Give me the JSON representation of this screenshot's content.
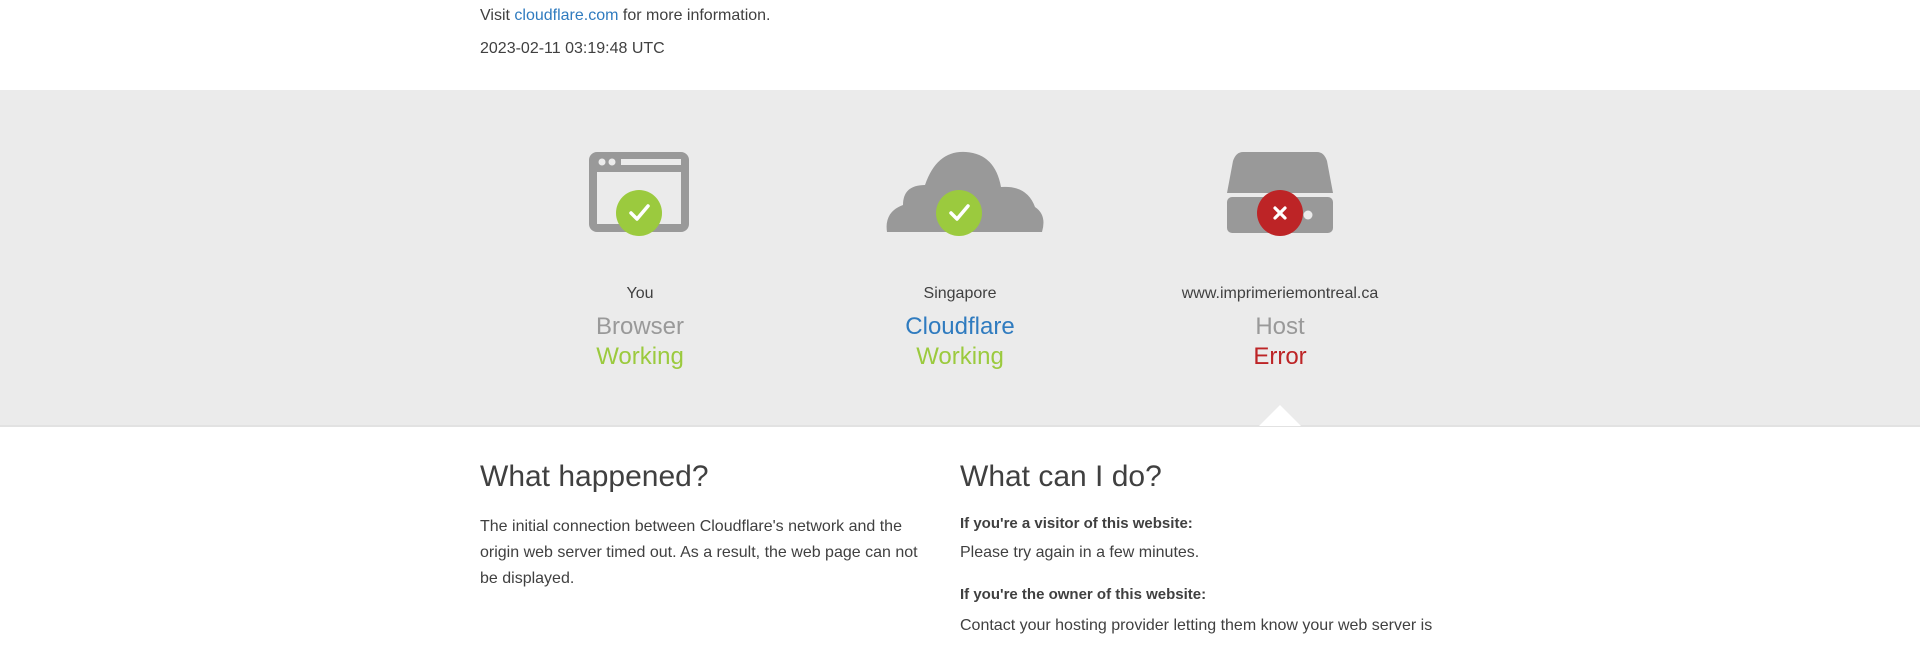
{
  "top": {
    "visit_prefix": "Visit",
    "link_text": "cloudflare.com",
    "visit_suffix": "for more information.",
    "timestamp": "2023-02-11 03:19:48 UTC"
  },
  "status": {
    "columns": [
      {
        "place": "You",
        "name": "Browser",
        "state": "Working",
        "icon": "browser-icon",
        "badge": "check-icon",
        "state_color": "#9bca3e"
      },
      {
        "place": "Singapore",
        "name": "Cloudflare",
        "state": "Working",
        "icon": "cloud-icon",
        "badge": "check-icon",
        "state_color": "#9bca3e"
      },
      {
        "place": "www.imprimeriemontreal.ca",
        "name": "Host",
        "state": "Error",
        "icon": "server-icon",
        "badge": "x-icon",
        "state_color": "#bd2426"
      }
    ]
  },
  "what_happened": {
    "heading": "What happened?",
    "body": "The initial connection between Cloudflare's network and the origin web server timed out. As a result, the web page can not be displayed."
  },
  "what_can_i_do": {
    "heading": "What can I do?",
    "visitor_heading": "If you're a visitor of this website:",
    "visitor_body": "Please try again in a few minutes.",
    "owner_heading": "If you're the owner of this website:",
    "owner_body": "Contact your hosting provider letting them know your web server is"
  },
  "colors": {
    "link": "#2f7bbf",
    "working": "#9bca3e",
    "error": "#bd2426",
    "icon_gray": "#999999",
    "band": "#ebebeb"
  }
}
